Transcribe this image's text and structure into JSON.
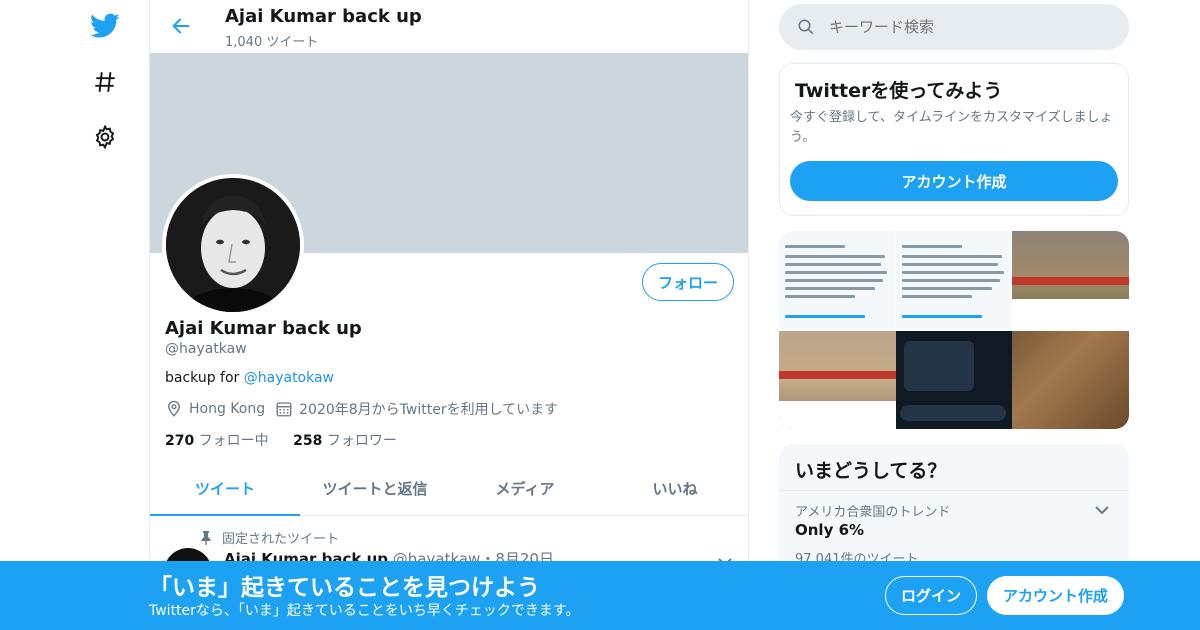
{
  "nav": {
    "icons": [
      "twitter-bird-icon",
      "hashtag-icon",
      "gear-icon"
    ]
  },
  "header": {
    "title": "Ajai Kumar back up",
    "tweet_count": "1,040 ツイート"
  },
  "profile": {
    "name": "Ajai Kumar back up",
    "handle": "@hayatkaw",
    "bio_prefix": "backup for ",
    "bio_link": "@hayatokaw",
    "location": "Hong Kong",
    "joined": "2020年8月からTwitterを利用しています",
    "following_count": "270",
    "following_label": "フォロー中",
    "followers_count": "258",
    "followers_label": "フォロワー",
    "follow_button": "フォロー"
  },
  "tabs": [
    "ツイート",
    "ツイートと返信",
    "メディア",
    "いいね"
  ],
  "pinned": {
    "label": "固定されたツイート",
    "author": "Ajai Kumar back up",
    "handle": "@hayatkaw",
    "date": "・8月20日"
  },
  "search": {
    "placeholder": "キーワード検索"
  },
  "signup_card": {
    "title": "Twitterを使ってみよう",
    "text": "今すぐ登録して、タイムラインをカスタマイズしましょう。",
    "button": "アカウント作成"
  },
  "trends": {
    "title": "いまどうしてる？",
    "items": [
      {
        "meta": "アメリカ合衆国のトレンド",
        "name": "Only 6%",
        "count": "97,041件のツイート"
      }
    ]
  },
  "bottom_bar": {
    "title": "「いま」起きていることを見つけよう",
    "subtitle": "Twitterなら、「いま」起きていることをいち早くチェックできます。",
    "login": "ログイン",
    "signup": "アカウント作成"
  },
  "colors": {
    "accent": "#1da1f2",
    "banner": "#ccd6dd",
    "muted_text": "#657786"
  }
}
